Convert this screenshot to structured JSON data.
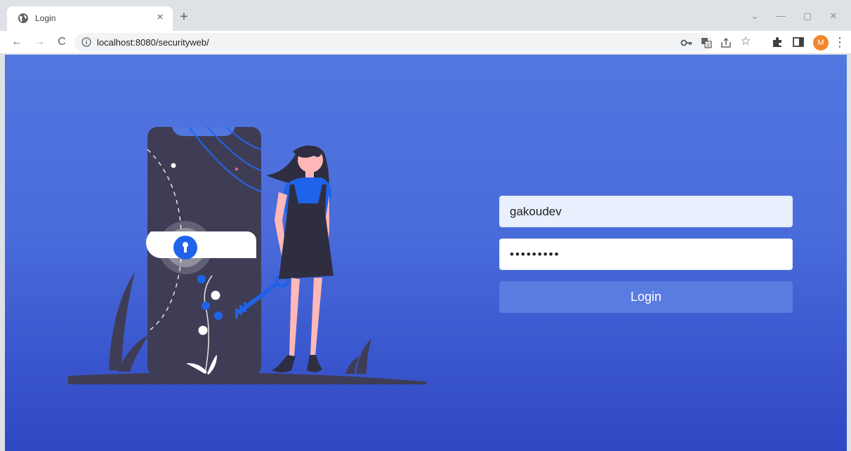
{
  "browser": {
    "tab": {
      "title": "Login",
      "close_glyph": "×"
    },
    "new_tab_glyph": "+",
    "window_controls": {
      "minimize": "—",
      "restore": "▢",
      "close": "✕",
      "tab_search": "⌄"
    },
    "nav": {
      "back": "←",
      "forward": "→",
      "reload": "C"
    },
    "address_bar": {
      "url": "localhost:8080/securityweb/"
    },
    "toolbar_icons": [
      "key-icon",
      "translate-icon",
      "share-icon",
      "bookmark-star-icon",
      "extensions-puzzle-icon",
      "side-panel-icon",
      "profile-avatar",
      "kebab-menu-icon"
    ],
    "profile": {
      "initial": "M",
      "color": "#f4852b"
    },
    "menu_glyph": "⋮",
    "star_glyph": "☆"
  },
  "page": {
    "background_top": "#5277df",
    "background_bottom": "#2f48c4",
    "illustration": "woman-with-key-unlocking-phone",
    "login": {
      "username_value": "gakoudev",
      "password_value": "•••••••••",
      "button_label": "Login",
      "button_color": "#5a7ce0"
    }
  }
}
